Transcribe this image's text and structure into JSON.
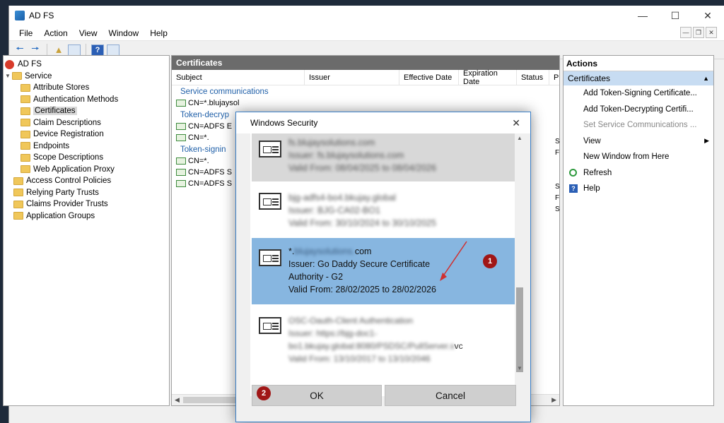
{
  "window": {
    "title": "AD FS"
  },
  "menu": [
    "File",
    "Action",
    "View",
    "Window",
    "Help"
  ],
  "tree": {
    "root": "AD FS",
    "service": "Service",
    "service_children": [
      "Attribute Stores",
      "Authentication Methods",
      "Certificates",
      "Claim Descriptions",
      "Device Registration",
      "Endpoints",
      "Scope Descriptions",
      "Web Application Proxy"
    ],
    "other": [
      "Access Control Policies",
      "Relying Party Trusts",
      "Claims Provider Trusts",
      "Application Groups"
    ],
    "selected": "Certificates"
  },
  "center": {
    "header": "Certificates",
    "columns": [
      "Subject",
      "Issuer",
      "Effective Date",
      "Expiration Date",
      "Status",
      "P"
    ],
    "groups": [
      {
        "label": "Service communications",
        "rows": [
          "CN=*.blujaysol"
        ]
      },
      {
        "label": "Token-decryp",
        "rows": [
          "CN=ADFS E",
          "CN=*."
        ]
      },
      {
        "label": "Token-signin",
        "rows": [
          "CN=*.",
          "CN=ADFS S",
          "CN=ADFS S"
        ]
      }
    ],
    "row_extras": [
      "S",
      "F",
      "S",
      "F",
      "S"
    ]
  },
  "actions": {
    "header": "Actions",
    "section": "Certificates",
    "items": [
      {
        "label": "Add Token-Signing Certificate...",
        "enabled": true
      },
      {
        "label": "Add Token-Decrypting Certifi...",
        "enabled": true
      },
      {
        "label": "Set Service Communications ...",
        "enabled": false
      },
      {
        "label": "View",
        "enabled": true
      },
      {
        "label": "New Window from Here",
        "enabled": true
      },
      {
        "label": "Refresh",
        "enabled": true
      },
      {
        "label": "Help",
        "enabled": true
      }
    ]
  },
  "dialog": {
    "title": "Windows Security",
    "certs": [
      {
        "lines": [
          "fs.blujaysolutions.com",
          "Issuer: fs.blujaysolutions.com",
          "Valid From: 08/04/2025 to 08/04/2026"
        ],
        "blurred": true
      },
      {
        "lines": [
          "bjg-adfs4-bo4.bkujay.global",
          "Issuer: BJG-CA02-BO1",
          "Valid From: 30/10/2024 to 30/10/2025"
        ],
        "blurred": true
      },
      {
        "lines": [
          "*.",
          "com",
          "Issuer: Go Daddy Secure Certificate",
          "Authority - G2",
          "Valid From: 28/02/2025 to 28/02/2026"
        ],
        "blurred": false
      },
      {
        "lines": [
          "OSC-Oauth-Client Authentication",
          "Issuer: https://bjg-doc1-",
          "bo1.bkujay.global:8080/PSDSC/PullServer.s",
          "vc",
          "Valid From: 13/10/2017 to 13/10/2046"
        ],
        "blurred": true
      }
    ],
    "ok": "OK",
    "cancel": "Cancel"
  },
  "badges": [
    "1",
    "2"
  ]
}
